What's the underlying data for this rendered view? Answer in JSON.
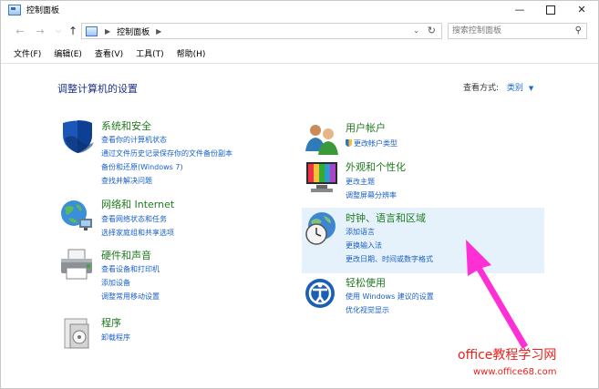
{
  "window": {
    "title": "控制面板"
  },
  "nav": {
    "address_crumb": "控制面板",
    "search_placeholder": "搜索控制面板"
  },
  "menu": [
    "文件(F)",
    "编辑(E)",
    "查看(V)",
    "工具(T)",
    "帮助(H)"
  ],
  "header": {
    "title": "调整计算机的设置",
    "view_by_label": "查看方式:",
    "view_by_value": "类别"
  },
  "categories": {
    "system_security": {
      "title": "系统和安全",
      "links": [
        "查看你的计算机状态",
        "通过文件历史记录保存你的文件备份副本",
        "备份和还原(Windows 7)",
        "查找并解决问题"
      ]
    },
    "network": {
      "title": "网络和 Internet",
      "links": [
        "查看网络状态和任务",
        "选择家庭组和共享选项"
      ]
    },
    "hardware": {
      "title": "硬件和声音",
      "links": [
        "查看设备和打印机",
        "添加设备",
        "调整常用移动设置"
      ]
    },
    "programs": {
      "title": "程序",
      "links": [
        "卸载程序"
      ]
    },
    "user_accounts": {
      "title": "用户帐户",
      "links": [
        "更改帐户类型"
      ]
    },
    "appearance": {
      "title": "外观和个性化",
      "links": [
        "更改主题",
        "调整屏幕分辨率"
      ]
    },
    "clock_region": {
      "title": "时钟、语言和区域",
      "links": [
        "添加语言",
        "更换输入法",
        "更改日期、时间或数字格式"
      ]
    },
    "ease_access": {
      "title": "轻松使用",
      "links": [
        "使用 Windows 建议的设置",
        "优化视觉显示"
      ]
    }
  },
  "watermark": {
    "line1": "office教程学习网",
    "line2": "www.office68.com"
  },
  "colors": {
    "category_title": "#1f7a1f",
    "link": "#1a5fc6",
    "heading": "#1e3287",
    "highlight": "#e6f2fb",
    "watermark": "#e8211e"
  }
}
